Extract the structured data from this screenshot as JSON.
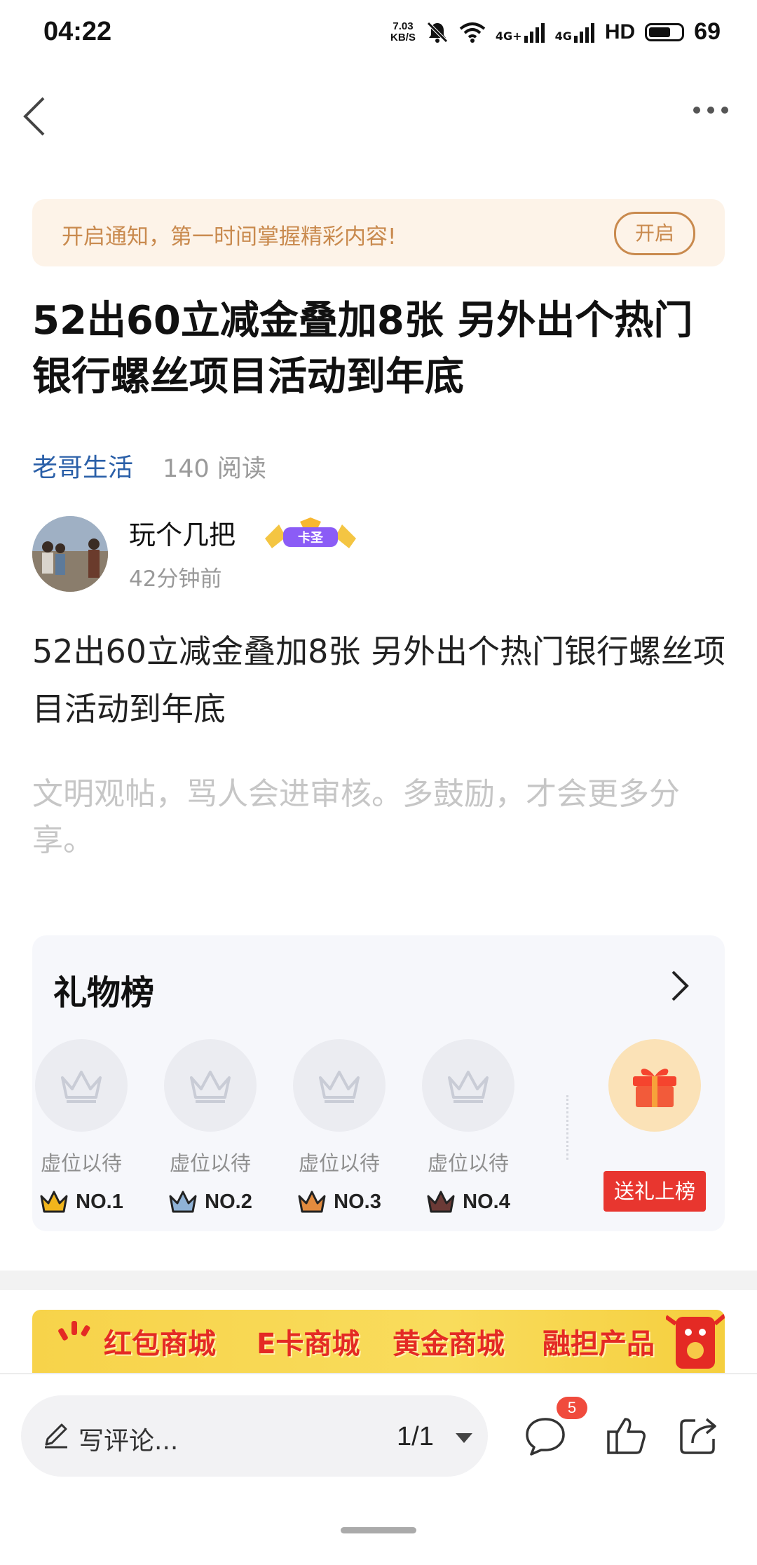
{
  "status_bar": {
    "time": "04:22",
    "net_speed_value": "7.03",
    "net_speed_unit": "KB/S",
    "signal1": "4G+",
    "signal2": "4G",
    "hd": "HD",
    "battery": "69"
  },
  "nav": {
    "back": "back-icon",
    "more": "more-icon"
  },
  "notice": {
    "text": "开启通知，第一时间掌握精彩内容!",
    "button": "开启"
  },
  "article": {
    "title": "52出60立减金叠加8张 另外出个热门银行螺丝项目活动到年底",
    "channel": "老哥生活",
    "reads": "140 阅读",
    "author": "玩个几把",
    "author_badge": "卡圣",
    "time_ago": "42分钟前",
    "body": "52出60立减金叠加8张 另外出个热门银行螺丝项目活动到年底",
    "hint": "文明观帖，骂人会进审核。多鼓励，才会更多分享。"
  },
  "gift_board": {
    "title": "礼物榜",
    "slots": [
      {
        "label": "虚位以待",
        "rank": "NO.1",
        "crown_color": "#f1b51c"
      },
      {
        "label": "虚位以待",
        "rank": "NO.2",
        "crown_color": "#8fb2d6"
      },
      {
        "label": "虚位以待",
        "rank": "NO.3",
        "crown_color": "#e38b3e"
      },
      {
        "label": "虚位以待",
        "rank": "NO.4",
        "crown_color": "#6b3a36"
      }
    ],
    "send_button": "送礼上榜"
  },
  "promo": {
    "items": [
      "红包商城",
      "E卡商城",
      "黄金商城",
      "融担产品"
    ]
  },
  "bottom_bar": {
    "comment_placeholder": "写评论...",
    "page_indicator": "1/1",
    "comment_count": "5"
  },
  "colors": {
    "accent_blue": "#2a5fa8",
    "notice_orange": "#c98a4e",
    "send_red": "#e8362f",
    "badge_red": "#f04b3d"
  }
}
